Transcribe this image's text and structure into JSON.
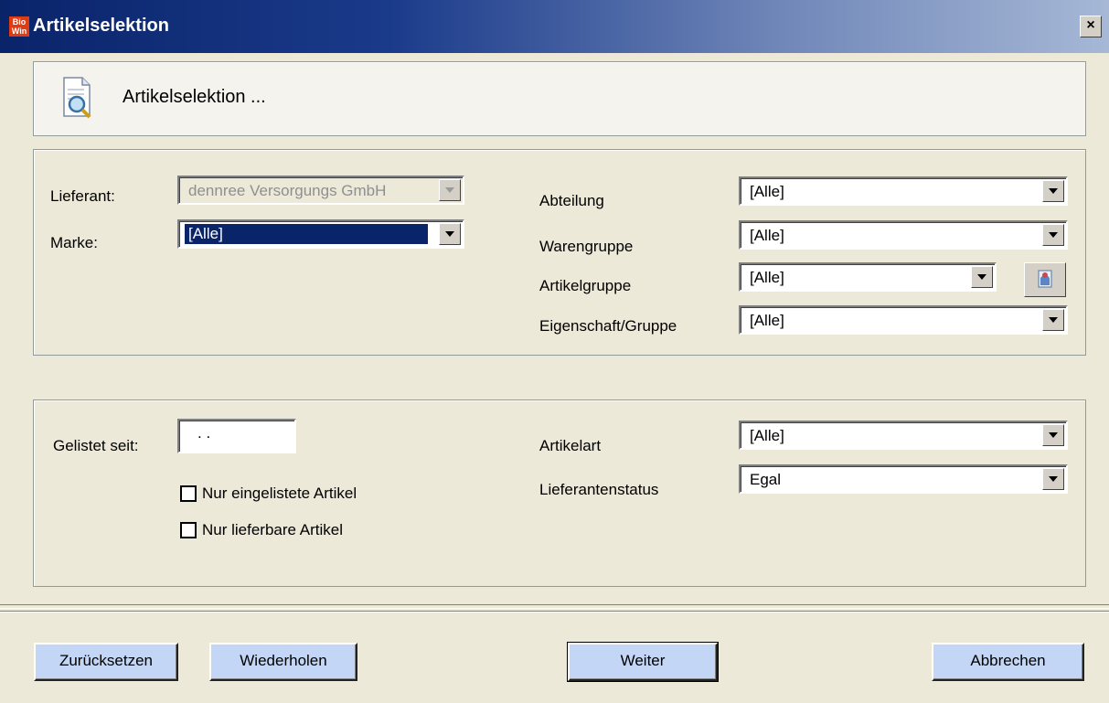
{
  "window": {
    "title": "Artikelselektion",
    "logo_top": "Bio",
    "logo_bottom": "Win",
    "close_label": "×"
  },
  "header": {
    "title": "Artikelselektion ..."
  },
  "selection": {
    "lieferant": {
      "label": "Lieferant:",
      "value": "dennree Versorgungs GmbH"
    },
    "marke": {
      "label": "Marke:",
      "value": "[Alle]"
    },
    "abteilung": {
      "label": "Abteilung",
      "value": "[Alle]"
    },
    "warengruppe": {
      "label": "Warengruppe",
      "value": "[Alle]"
    },
    "artikelgruppe": {
      "label": "Artikelgruppe",
      "value": "[Alle]"
    },
    "eigenschaft": {
      "label": "Eigenschaft/Gruppe",
      "value": "[Alle]"
    }
  },
  "filters": {
    "gelistet_seit": {
      "label": "Gelistet seit:",
      "value": ". ."
    },
    "nur_eingelistete": {
      "label": "Nur eingelistete Artikel",
      "checked": false
    },
    "nur_lieferbare": {
      "label": "Nur lieferbare Artikel",
      "checked": false
    },
    "artikelart": {
      "label": "Artikelart",
      "value": "[Alle]"
    },
    "lieferantenstatus": {
      "label": "Lieferantenstatus",
      "value": "Egal"
    }
  },
  "buttons": {
    "reset": "Zurücksetzen",
    "repeat": "Wiederholen",
    "next": "Weiter",
    "cancel": "Abbrechen"
  },
  "colors": {
    "titlebar_start": "#0a246a",
    "button_face": "#c3d6f5",
    "dialog_bg": "#ece9d8",
    "selection_bg": "#0a246a"
  },
  "icons": {
    "header": "document-magnifier-icon",
    "artikelgruppe_button": "tree-selector-icon"
  }
}
